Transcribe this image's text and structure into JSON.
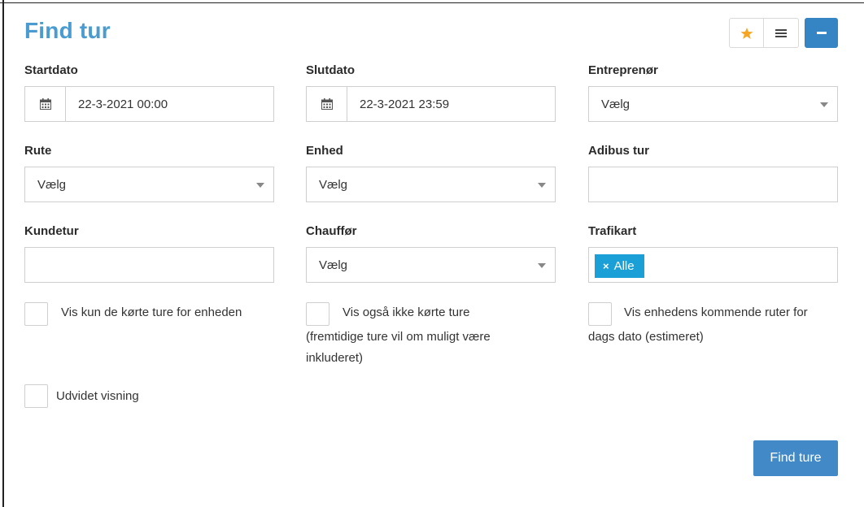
{
  "title": "Find tur",
  "toolbar": {
    "star_icon": "star-icon",
    "menu_icon": "menu-icon",
    "collapse_icon": "minus-icon"
  },
  "fields": {
    "startdato": {
      "label": "Startdato",
      "value": "22-3-2021 00:00",
      "icon": "calendar-icon"
    },
    "slutdato": {
      "label": "Slutdato",
      "value": "22-3-2021 23:59",
      "icon": "calendar-icon"
    },
    "entreprenor": {
      "label": "Entreprenør",
      "value": "Vælg"
    },
    "rute": {
      "label": "Rute",
      "value": "Vælg"
    },
    "enhed": {
      "label": "Enhed",
      "value": "Vælg"
    },
    "adibus_tur": {
      "label": "Adibus tur",
      "value": ""
    },
    "kundetur": {
      "label": "Kundetur",
      "value": ""
    },
    "chauffor": {
      "label": "Chauffør",
      "value": "Vælg"
    },
    "trafikart": {
      "label": "Trafikart",
      "tag": "Alle",
      "tag_remove": "×"
    }
  },
  "checkboxes": {
    "vis_kun_korte": {
      "line1": "Vis kun de kørte ture for enheden",
      "checked": false
    },
    "vis_ikke_korte": {
      "line1": "Vis også ikke kørte ture",
      "line2": "(fremtidige ture vil om muligt være",
      "line3": "inkluderet)",
      "checked": false
    },
    "vis_kommende": {
      "line1": "Vis enhedens kommende ruter for",
      "line2": "dags dato (estimeret)",
      "checked": false
    },
    "udvidet": {
      "line1": "Udvidet visning",
      "checked": false
    }
  },
  "submit_label": "Find ture",
  "colors": {
    "title": "#4a9bcf",
    "primary_button": "#4189c7",
    "collapse_button": "#3584c3",
    "tag": "#1a9fd6",
    "star": "#f5a623"
  }
}
